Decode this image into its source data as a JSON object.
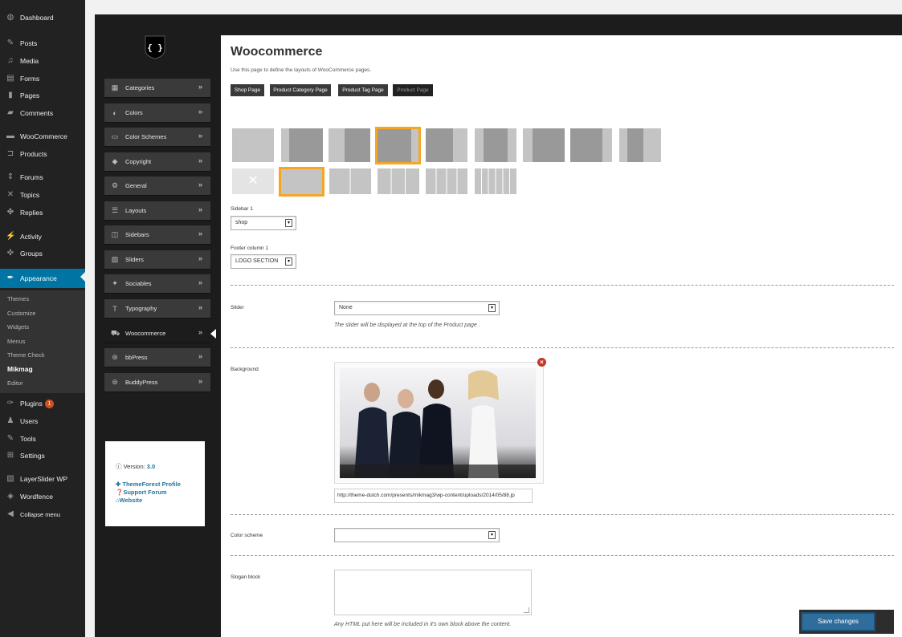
{
  "wp_menu": {
    "items": [
      {
        "label": "Dashboard",
        "icon": "dashboard-icon",
        "glyph": "◍"
      },
      {
        "label": "Posts",
        "icon": "pin-icon",
        "glyph": "✎"
      },
      {
        "label": "Media",
        "icon": "media-icon",
        "glyph": "♫"
      },
      {
        "label": "Forms",
        "icon": "forms-icon",
        "glyph": "▤"
      },
      {
        "label": "Pages",
        "icon": "pages-icon",
        "glyph": "▮"
      },
      {
        "label": "Comments",
        "icon": "comments-icon",
        "glyph": "▰"
      },
      {
        "label": "WooCommerce",
        "icon": "woocommerce-icon",
        "glyph": "▬"
      },
      {
        "label": "Products",
        "icon": "products-icon",
        "glyph": "⊐"
      },
      {
        "label": "Forums",
        "icon": "forums-icon",
        "glyph": "⇕"
      },
      {
        "label": "Topics",
        "icon": "topics-icon",
        "glyph": "✕"
      },
      {
        "label": "Replies",
        "icon": "replies-icon",
        "glyph": "✤"
      },
      {
        "label": "Activity",
        "icon": "activity-icon",
        "glyph": "⚡"
      },
      {
        "label": "Groups",
        "icon": "groups-icon",
        "glyph": "✜"
      },
      {
        "label": "Appearance",
        "icon": "brush-icon",
        "glyph": "✒"
      },
      {
        "label": "Plugins",
        "icon": "plugins-icon",
        "glyph": "✑",
        "badge": "1"
      },
      {
        "label": "Users",
        "icon": "users-icon",
        "glyph": "♟"
      },
      {
        "label": "Tools",
        "icon": "tools-icon",
        "glyph": "✎"
      },
      {
        "label": "Settings",
        "icon": "settings-icon",
        "glyph": "⊞"
      },
      {
        "label": "LayerSlider WP",
        "icon": "layerslider-icon",
        "glyph": "▧"
      },
      {
        "label": "Wordfence",
        "icon": "wordfence-icon",
        "glyph": "◈"
      },
      {
        "label": "Collapse menu",
        "icon": "collapse-icon",
        "glyph": "◀"
      }
    ],
    "appearance_sub": [
      "Themes",
      "Customize",
      "Widgets",
      "Menus",
      "Theme Check",
      "Mikmag",
      "Editor"
    ]
  },
  "theme_nav": {
    "logo": "{ }",
    "items": [
      {
        "label": "Categories",
        "icon": "grid-icon",
        "glyph": "▦"
      },
      {
        "label": "Colors",
        "icon": "contrast-icon",
        "glyph": "◐"
      },
      {
        "label": "Color Schemes",
        "icon": "laptop-icon",
        "glyph": "▭"
      },
      {
        "label": "Copyright",
        "icon": "tag-icon",
        "glyph": "◆"
      },
      {
        "label": "General",
        "icon": "cogs-icon",
        "glyph": "⚙"
      },
      {
        "label": "Layouts",
        "icon": "list-icon",
        "glyph": "☰"
      },
      {
        "label": "Sidebars",
        "icon": "columns-icon",
        "glyph": "◫"
      },
      {
        "label": "Sliders",
        "icon": "image-icon",
        "glyph": "▨"
      },
      {
        "label": "Sociables",
        "icon": "twitter-icon",
        "glyph": "✦"
      },
      {
        "label": "Typography",
        "icon": "text-icon",
        "glyph": "T"
      },
      {
        "label": "Woocommerce",
        "icon": "cart-icon",
        "glyph": "⛟"
      },
      {
        "label": "bbPress",
        "icon": "bbpress-icon",
        "glyph": "⊛"
      },
      {
        "label": "BuddyPress",
        "icon": "buddypress-icon",
        "glyph": "⊜"
      }
    ],
    "arrow": "»",
    "info": {
      "version_label": "Version:",
      "version": "3.0",
      "links": [
        "ThemeForest Profile",
        "Support Forum",
        "Website"
      ]
    }
  },
  "main": {
    "title": "Woocommerce",
    "description": "Use this page to define the layouts of WooCommerce pages.",
    "tabs": [
      "Shop Page",
      "Product Category Page",
      "Product Tag Page",
      "Product Page"
    ],
    "active_tab": "Product Page",
    "sidebar1": {
      "label": "Sidebar 1",
      "value": "shop"
    },
    "footer1": {
      "label": "Footer column 1",
      "value": "LOGO SECTION"
    },
    "slider": {
      "label": "Slider",
      "value": "None",
      "hint": "The slider will be displayed at the top of the Product page ."
    },
    "background": {
      "label": "Background",
      "url": "http://theme-dutch.com/presents/mikmag3/wp-content/uploads/2014/05/88.jp"
    },
    "color_scheme": {
      "label": "Color scheme",
      "value": ""
    },
    "slogan": {
      "label": "Slogan block",
      "hint": "Any HTML put here will be included in it's own block above the content."
    },
    "save": "Save changes",
    "dropdown_glyph": "▾",
    "close_glyph": "×",
    "none_layout_glyph": "✕"
  },
  "colors": {
    "accent": "#f6a623",
    "wp_active": "#0074a2",
    "save": "#2e6d9c"
  }
}
